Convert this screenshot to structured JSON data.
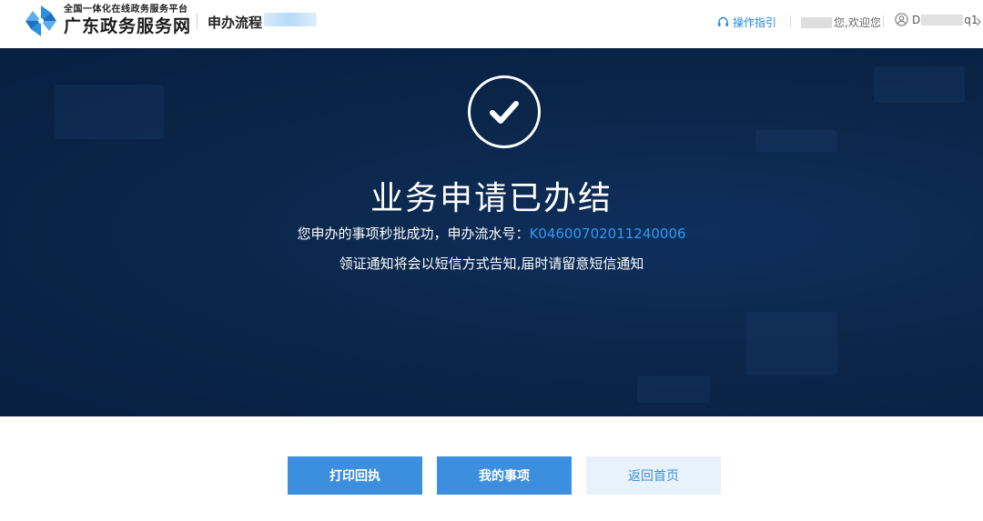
{
  "header": {
    "brand_subtitle": "全国一体化在线政务服务平台",
    "brand_name": "广东政务服务网",
    "process_title": "申办流程",
    "guide_label": "操作指引",
    "welcome_text": "您,欢迎您",
    "user_prefix": "D",
    "user_suffix": "q1",
    "colors": {
      "accent": "#1e88e5",
      "logo": "#2d8fe0"
    }
  },
  "banner": {
    "title": "业务申请已办结",
    "result_text": "您申办的事项秒批成功，申办流水号：",
    "serial_number": "K04600702011240006",
    "notice_text": "领证通知将会以短信方式告知,届时请留意短信通知",
    "icon": "check-circle-icon",
    "colors": {
      "background": "#0a2548",
      "serial": "#2f9bf0"
    }
  },
  "actions": {
    "print_label": "打印回执",
    "my_items_label": "我的事项",
    "home_label": "返回首页",
    "colors": {
      "primary": "#3c8fde",
      "light": "#e8f2fb"
    }
  }
}
